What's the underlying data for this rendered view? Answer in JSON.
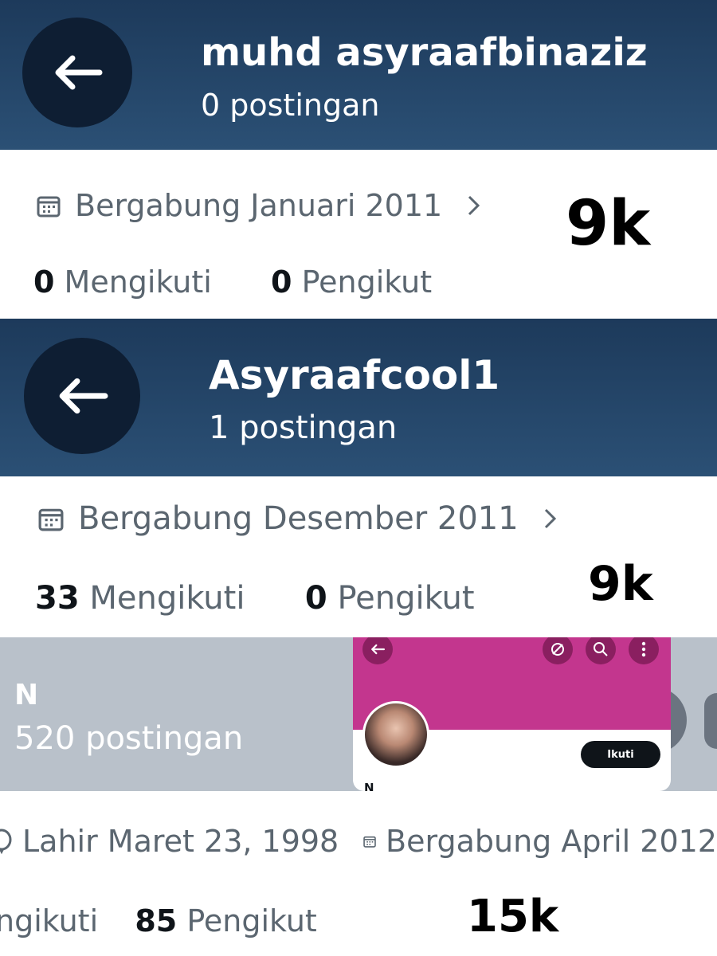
{
  "panels": [
    {
      "name": "muhd asyraafbinaziz",
      "posts": "0 postingan",
      "joined": "Bergabung Januari 2011",
      "following_count": "0",
      "following_label": "Mengikuti",
      "followers_count": "0",
      "followers_label": "Pengikut",
      "annotation": "9k"
    },
    {
      "name": "Asyraafcool1",
      "posts": "1 postingan",
      "joined": "Bergabung Desember 2011",
      "following_count": "33",
      "following_label": "Mengikuti",
      "followers_count": "0",
      "followers_label": "Pengikut",
      "annotation": "9k"
    },
    {
      "name": "N",
      "posts": "520 postingan",
      "birth": "Lahir Maret 23, 1998",
      "joined": "Bergabung April 2012",
      "following_label": "ngikuti",
      "followers_count": "85",
      "followers_label": "Pengikut",
      "annotation": "15k",
      "inset": {
        "follow_button": "Ikuti",
        "name": "N"
      }
    }
  ],
  "colors": {
    "header": "#1d3a5b",
    "back_circle": "#0e1e33",
    "grey_header": "#b9c1ca",
    "inset_banner": "#c3368e"
  },
  "icons": [
    "back-arrow-icon",
    "calendar-icon",
    "chevron-right-icon",
    "balloon-icon",
    "unfollow-icon",
    "search-icon",
    "more-icon"
  ]
}
